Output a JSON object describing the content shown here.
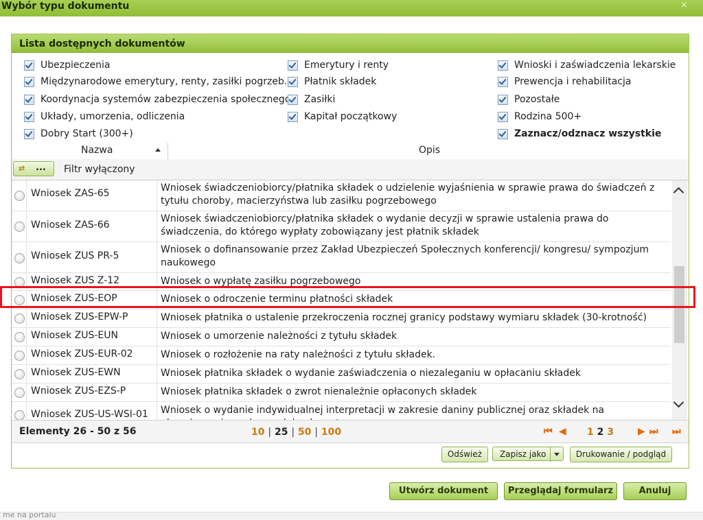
{
  "dialog": {
    "title": "Wybór typu dokumentu",
    "close_glyph": "×"
  },
  "list": {
    "header": "Lista dostępnych dokumentów",
    "filters": [
      {
        "label": "Ubezpieczenia",
        "checked": true
      },
      {
        "label": "Międzynarodowe emerytury, renty, zasiłki pogrzeb.",
        "checked": true
      },
      {
        "label": "Koordynacja systemów zabezpieczenia społecznego",
        "checked": true
      },
      {
        "label": "Układy, umorzenia, odliczenia",
        "checked": true
      },
      {
        "label": "Dobry Start (300+)",
        "checked": true
      },
      {
        "label": "Emerytury i renty",
        "checked": true
      },
      {
        "label": "Płatnik składek",
        "checked": true
      },
      {
        "label": "Zasiłki",
        "checked": true
      },
      {
        "label": "Kapitał początkowy",
        "checked": true
      },
      {
        "label": "Wnioski i zaświadczenia lekarskie",
        "checked": true
      },
      {
        "label": "Prewencja i rehabilitacja",
        "checked": true
      },
      {
        "label": "Pozostałe",
        "checked": true
      },
      {
        "label": "Rodzina 500+",
        "checked": true
      },
      {
        "label": "Zaznacz/odznacz wszystkie",
        "checked": true
      }
    ]
  },
  "table": {
    "columns": {
      "name": "Nazwa",
      "desc": "Opis"
    },
    "filter_button": "...",
    "filter_status": "Filtr wyłączony",
    "rows": [
      {
        "name": "Wniosek ZAS-65",
        "desc": "Wniosek świadczeniobiorcy/płatnika składek o udzielenie wyjaśnienia w sprawie prawa do świadczeń z tytułu choroby, macierzyństwa lub zasiłku pogrzebowego"
      },
      {
        "name": "Wniosek ZAS-66",
        "desc": "Wniosek świadczeniobiorcy/płatnika składek o wydanie decyzji w sprawie ustalenia prawa do świadczenia, do którego wypłaty zobowiązany jest płatnik składek"
      },
      {
        "name": "Wniosek ZUS PR-5",
        "desc": "Wniosek o dofinansowanie przez Zakład Ubezpieczeń Społecznych konferencji/ kongresu/ sympozjum naukowego"
      },
      {
        "name": "Wniosek ZUS Z-12",
        "desc": "Wniosek o wypłatę zasiłku pogrzebowego"
      },
      {
        "name": "Wniosek ZUS-EOP",
        "desc": "Wniosek o odroczenie terminu płatności składek"
      },
      {
        "name": "Wniosek ZUS-EPW-P",
        "desc": "Wniosek płatnika o ustalenie przekroczenia rocznej granicy podstawy wymiaru składek (30-krotność)"
      },
      {
        "name": "Wniosek ZUS-EUN",
        "desc": "Wniosek o umorzenie należności z tytułu składek"
      },
      {
        "name": "Wniosek ZUS-EUR-02",
        "desc": "Wniosek o rozłożenie na raty należności z tytułu składek."
      },
      {
        "name": "Wniosek ZUS-EWN",
        "desc": "Wniosek płatnika składek o wydanie zaświadczenia o niezaleganiu w opłacaniu składek"
      },
      {
        "name": "Wniosek ZUS-EZS-P",
        "desc": "Wniosek płatnika składek o zwrot nienależnie opłaconych składek"
      },
      {
        "name": "Wniosek ZUS-US-WSI-01",
        "desc": "Wniosek o wydanie indywidualnej interpretacji w zakresie daniny publicznej oraz składek na ubezpieczenia społeczne lub zdrowotne"
      }
    ]
  },
  "pager": {
    "range_text": "Elementy 26 - 50 z 56",
    "page_sizes": [
      "10",
      "25",
      "50",
      "100"
    ],
    "page_size_current": "25",
    "nav_first": "⏮",
    "nav_prev": "◀",
    "nav_next": "▶",
    "nav_last": "⏭",
    "nav_extra": "⏭",
    "pages": [
      "1",
      "2",
      "3"
    ],
    "page_current": "2"
  },
  "grid_buttons": {
    "refresh": "Odśwież",
    "save_as": "Zapisz jako",
    "print": "Drukowanie / podgląd"
  },
  "actions": {
    "create": "Utwórz dokument",
    "browse": "Przeglądaj formularz",
    "cancel": "Anuluj"
  },
  "background_fragment": "me na portalu",
  "colors": {
    "accent_green": "#9ec244",
    "highlight_red": "#e8141b",
    "link_orange": "#c97b12"
  }
}
